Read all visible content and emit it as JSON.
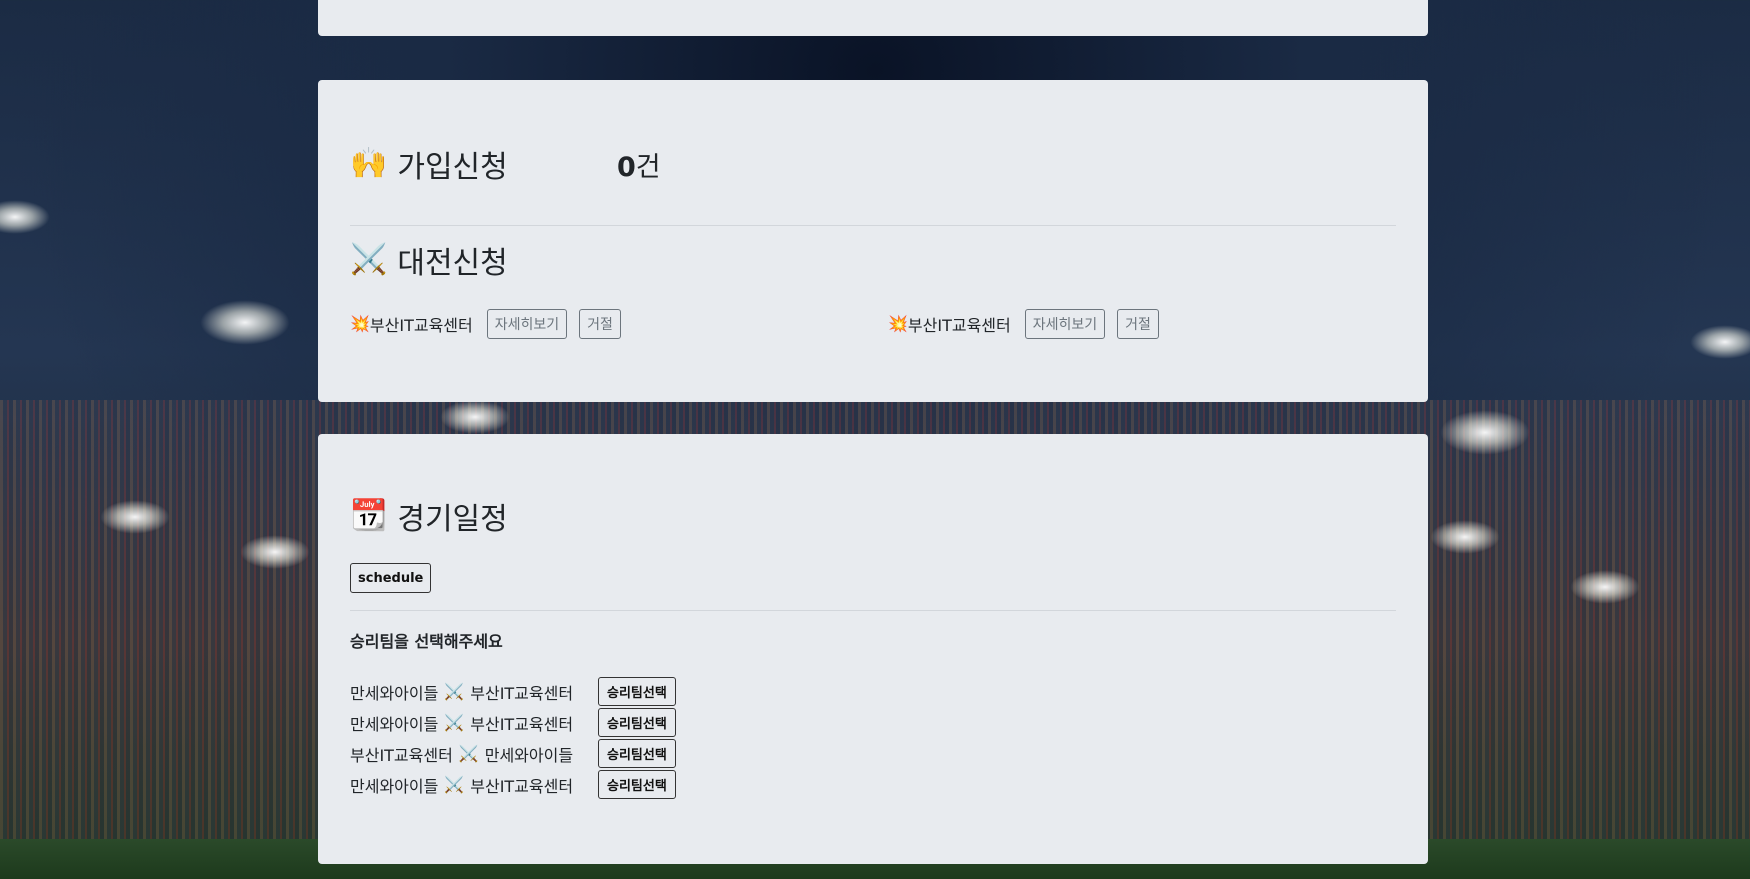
{
  "requests": {
    "join": {
      "icon": "🙌",
      "title": "가입신청",
      "count_number": "0",
      "count_unit": "건"
    },
    "match": {
      "icon": "⚔️",
      "title": "대전신청",
      "items": [
        {
          "icon": "💥",
          "team": "부산IT교육센터",
          "detail_label": "자세히보기",
          "reject_label": "거절"
        },
        {
          "icon": "💥",
          "team": "부산IT교육센터",
          "detail_label": "자세히보기",
          "reject_label": "거절"
        }
      ]
    }
  },
  "schedule": {
    "icon": "📆",
    "title": "경기일정",
    "schedule_button": "schedule",
    "select_prompt": "승리팀을 선택해주세요",
    "vs_icon": "⚔️",
    "select_button": "승리팀선택",
    "matches": [
      {
        "home": "만세와아이들",
        "away": "부산IT교육센터"
      },
      {
        "home": "만세와아이들",
        "away": "부산IT교육센터"
      },
      {
        "home": "부산IT교육센터",
        "away": "만세와아이들"
      },
      {
        "home": "만세와아이들",
        "away": "부산IT교육센터"
      }
    ]
  }
}
